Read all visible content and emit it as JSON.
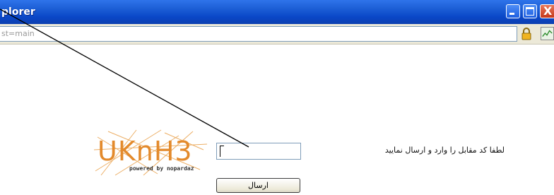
{
  "window": {
    "title": "plorer",
    "buttons": {
      "minimize_icon": "minimize-icon",
      "maximize_icon": "maximize-icon",
      "close_icon": "close-icon",
      "close_glyph": "X"
    }
  },
  "address_bar": {
    "url": "st=main",
    "lock_icon": "lock-icon",
    "feed_icon": "feed-icon"
  },
  "form": {
    "captcha": {
      "letters": "UKnH3",
      "powered_by": "powered by nopardaz",
      "color": "#e38a2c"
    },
    "code_input": {
      "value": "",
      "placeholder": ""
    },
    "prompt": "لطفا کد مقابل را وارد و ارسال نمایید",
    "submit_label": "ارسال"
  }
}
